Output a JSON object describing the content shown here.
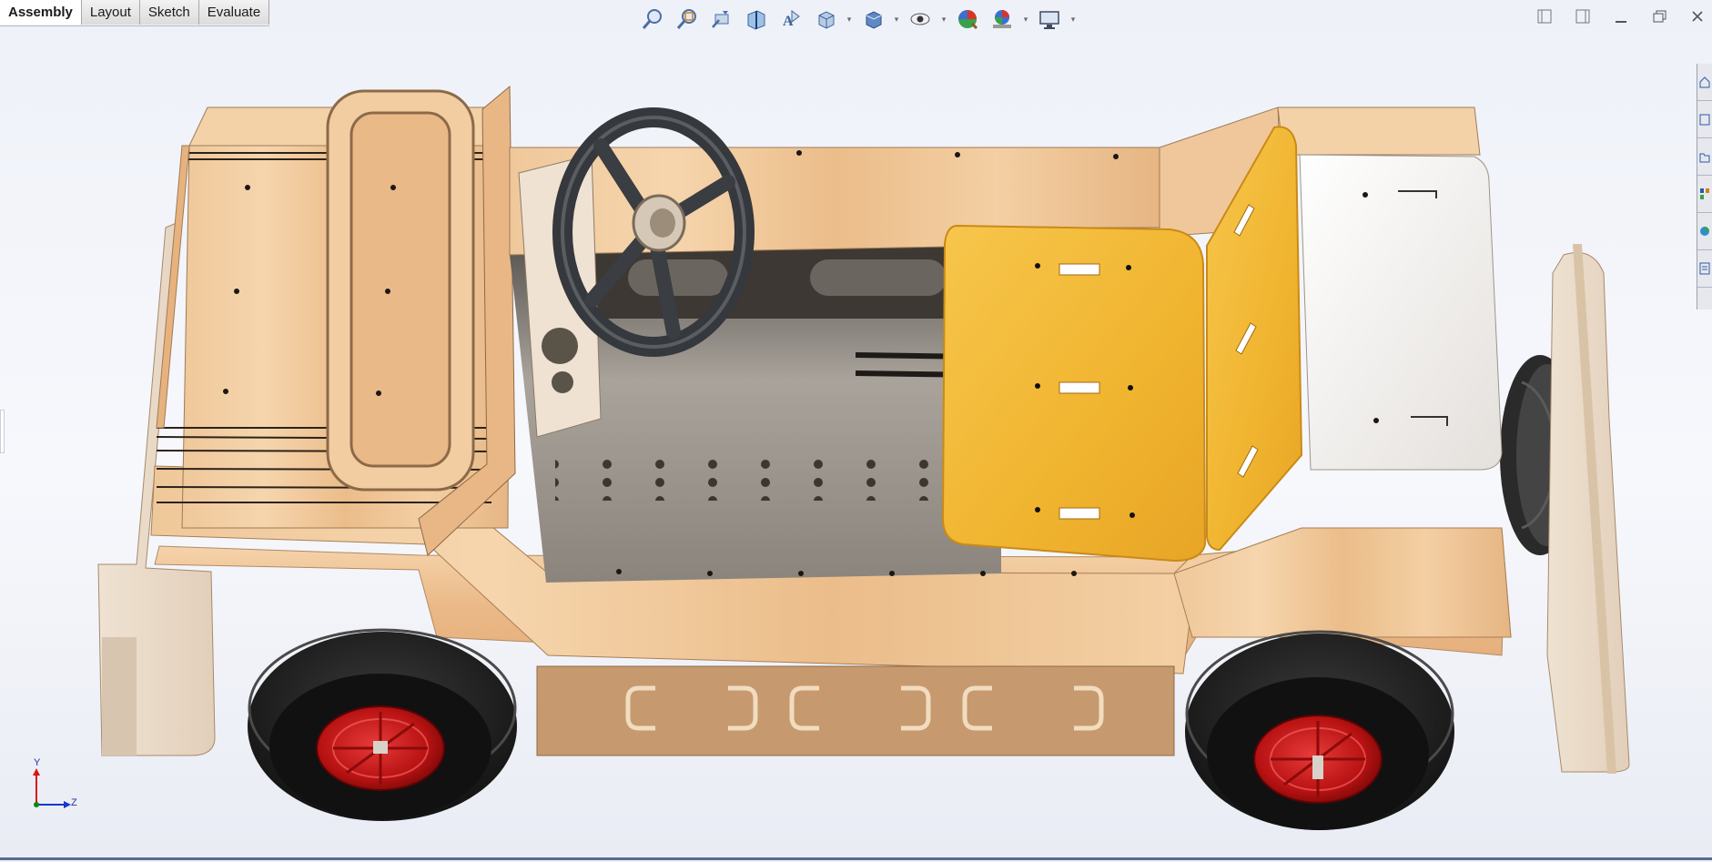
{
  "tabs": [
    {
      "label": "Assembly",
      "active": true
    },
    {
      "label": "Layout",
      "active": false
    },
    {
      "label": "Sketch",
      "active": false
    },
    {
      "label": "Evaluate",
      "active": false
    }
  ],
  "heads_up_toolbar": [
    "zoom-to-fit-icon",
    "zoom-to-area-icon",
    "previous-view-icon",
    "section-view-icon",
    "dynamic-annotation-views-icon",
    "view-orientation-icon",
    "display-style-icon",
    "hide-show-items-icon",
    "edit-appearance-icon",
    "apply-scene-icon",
    "view-settings-icon"
  ],
  "window_controls": [
    "tile-left-icon",
    "tile-right-icon",
    "minimize-icon",
    "restore-icon",
    "close-icon"
  ],
  "triad": {
    "y_label": "Y",
    "z_label": "Z"
  },
  "colors": {
    "plywood": "#e8b985",
    "seat_foam": "#f3b93a",
    "tire": "#2b2b2b",
    "rim": "#c01515",
    "steering_wheel": "#3a3d41",
    "background_top": "#eef1f8"
  }
}
